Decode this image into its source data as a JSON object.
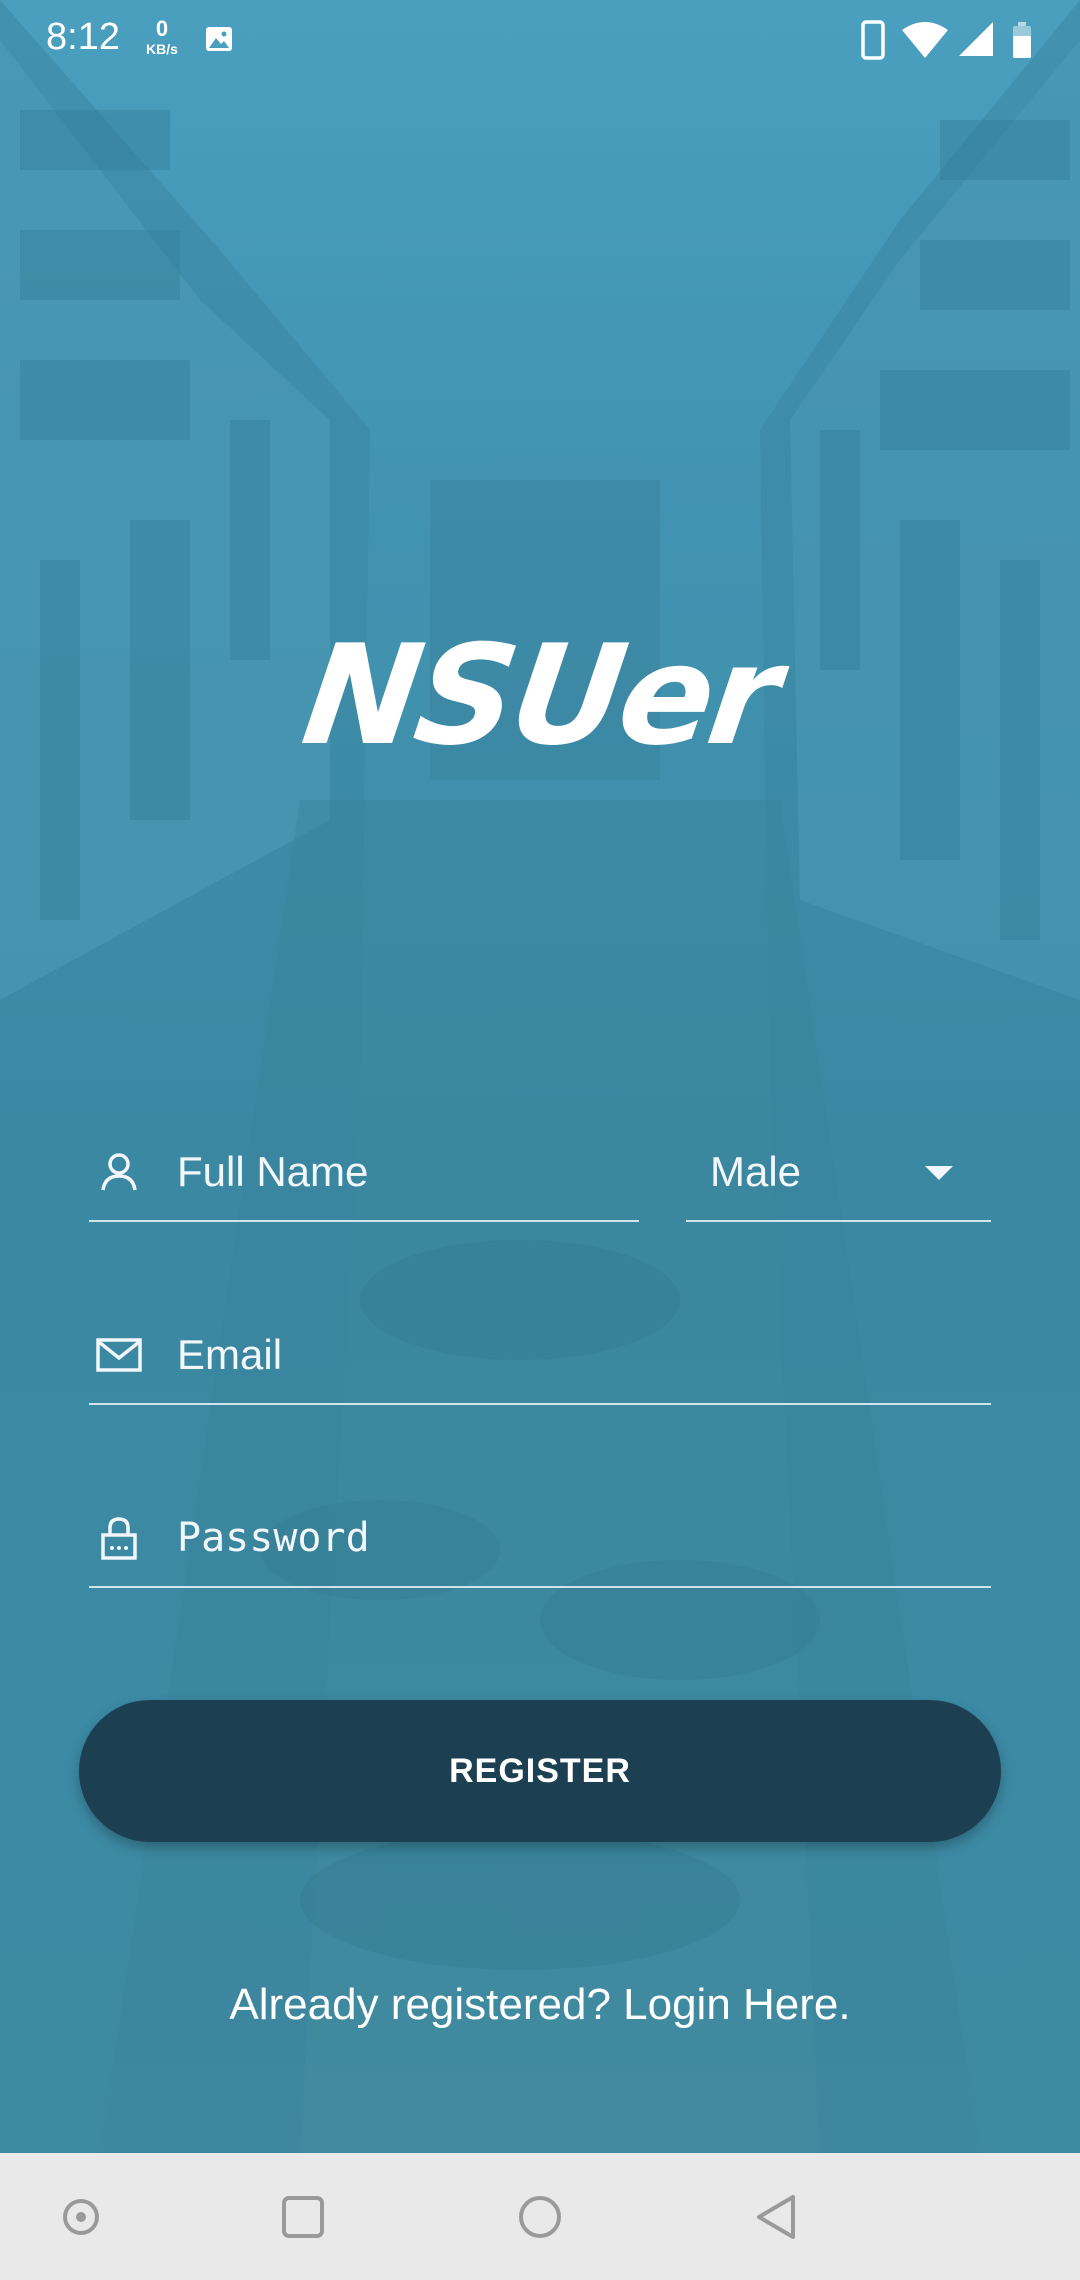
{
  "status_bar": {
    "time": "8:12",
    "net_speed_value": "0",
    "net_speed_unit": "KB/s",
    "icons": [
      "image-notification-icon",
      "phone-icon",
      "wifi-icon",
      "cell-signal-icon",
      "battery-icon"
    ]
  },
  "app": {
    "logo_text": "NSUer"
  },
  "form": {
    "full_name_placeholder": "Full Name",
    "gender_value": "Male",
    "email_placeholder": "Email",
    "password_placeholder": "Password",
    "register_label": "REGISTER",
    "login_link_text": "Already registered? Login Here."
  },
  "nav_bar": {
    "buttons": [
      "assist-icon",
      "recents-icon",
      "home-icon",
      "back-icon"
    ]
  },
  "colors": {
    "background": "#4295b3",
    "button": "#1c3f52",
    "nav_bar": "#e9e9e9",
    "text": "#ffffff"
  }
}
